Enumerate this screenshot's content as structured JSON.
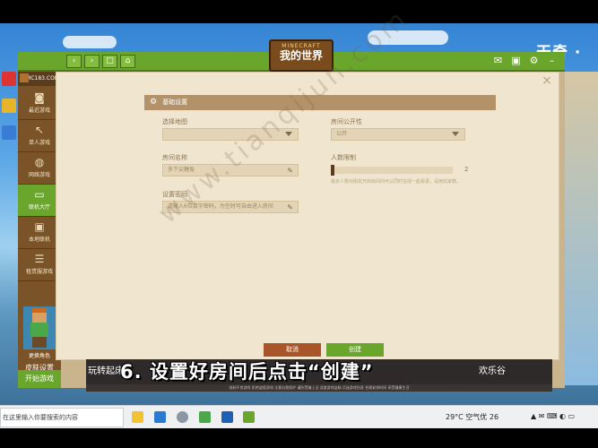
{
  "brand_watermark": "天奇 · 初",
  "window": {
    "logo_small": "MINECRAFT",
    "logo_title": "我的世界"
  },
  "sidebar": {
    "account": "MC183.COM",
    "items": [
      {
        "label": "最近游戏",
        "icon": "gamepad-icon"
      },
      {
        "label": "单人游戏",
        "icon": "arrow-icon"
      },
      {
        "label": "网络游戏",
        "icon": "globe-icon"
      },
      {
        "label": "联机大厅",
        "icon": "monitor-icon"
      },
      {
        "label": "本地联机",
        "icon": "computer-icon"
      },
      {
        "label": "租赁服游戏",
        "icon": "server-icon"
      }
    ],
    "skin_label": "更换角色",
    "skin_button": "皮肤设置",
    "start_button": "开始游戏"
  },
  "modal": {
    "section_title": "基础设置",
    "map_label": "选择地图",
    "map_value": "",
    "visibility_label": "房间公开性",
    "visibility_value": "公开",
    "room_name_label": "房间名称",
    "room_name_value": "多下尖糖兔",
    "player_limit_label": "人数限制",
    "player_limit_max": "2",
    "player_limit_hint": "最多人数对朋友开启房间内可以同时在线一起看录，请用玩家数。",
    "password_label": "设置密码",
    "password_placeholder": "请输入6位数字密码，为空时可自由进入房间",
    "cancel_label": "取消",
    "create_label": "创建"
  },
  "banner": {
    "left_text": "玩转起床",
    "right_text": "欢乐谷",
    "footer": "抵制不良游戏 拒绝盗版游戏 注意自我保护 谨防受骗上当 适度游戏益脑 沉迷游戏伤身 合理安排时间 享受健康生活"
  },
  "subtitle": "6. 设置好房间后点击“创建”",
  "site_watermark": "www.tianqijun.com",
  "taskbar": {
    "search_placeholder": "在这里输入你要搜索的内容",
    "weather": "29°C 空气优 26"
  },
  "colors": {
    "accent_green": "#6aa52c",
    "wood_brown": "#7b5328",
    "cancel_red": "#a8552a",
    "panel_beige": "#f0e5cf"
  }
}
